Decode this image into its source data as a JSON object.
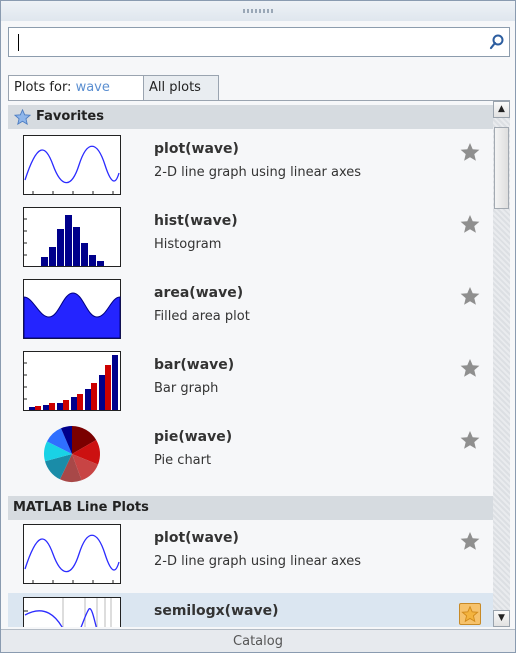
{
  "search": {
    "value": ""
  },
  "tabs": [
    {
      "prefix": "Plots for: ",
      "var": "wave"
    },
    {
      "label": "All plots"
    }
  ],
  "sections": {
    "favorites": "Favorites",
    "line_plots": "MATLAB Line Plots"
  },
  "favorites": [
    {
      "name": "plot(wave)",
      "desc": "2-D line graph using linear axes",
      "thumb": "line-thumb"
    },
    {
      "name": "hist(wave)",
      "desc": "Histogram",
      "thumb": "hist-thumb"
    },
    {
      "name": "area(wave)",
      "desc": "Filled area plot",
      "thumb": "area-thumb"
    },
    {
      "name": "bar(wave)",
      "desc": "Bar graph",
      "thumb": "bar-thumb"
    },
    {
      "name": "pie(wave)",
      "desc": "Pie chart",
      "thumb": "pie-thumb"
    }
  ],
  "line_plots": [
    {
      "name": "plot(wave)",
      "desc": "2-D line graph using linear axes",
      "thumb": "line-thumb"
    },
    {
      "name": "semilogx(wave)",
      "desc": "",
      "thumb": "semilogx-thumb",
      "selected": true
    }
  ],
  "status": {
    "label": "Catalog"
  },
  "colors": {
    "accent": "#5b8fd1",
    "star_gray": "#8f8f8f",
    "star_on": "#f6c26c",
    "plot_blue": "#0000cc",
    "plot_red": "#cc0000"
  }
}
